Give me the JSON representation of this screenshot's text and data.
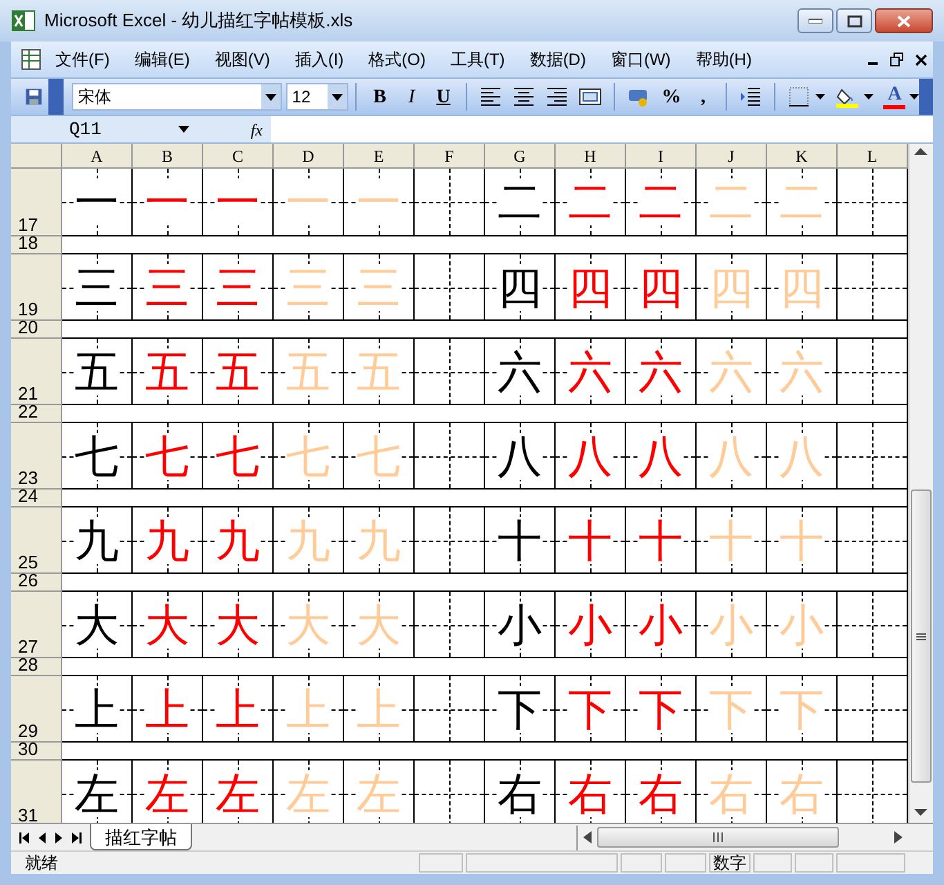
{
  "window": {
    "title": "Microsoft Excel - 幼儿描红字帖模板.xls"
  },
  "menu": [
    "文件(F)",
    "编辑(E)",
    "视图(V)",
    "插入(I)",
    "格式(O)",
    "工具(T)",
    "数据(D)",
    "窗口(W)",
    "帮助(H)"
  ],
  "toolbar": {
    "font": "宋体",
    "size": "12",
    "groups": [
      [
        {
          "kind": "bold",
          "label": "B"
        },
        {
          "kind": "italic",
          "label": "I"
        },
        {
          "kind": "underline",
          "label": "U"
        }
      ],
      [
        {
          "kind": "align-left"
        },
        {
          "kind": "align-center"
        },
        {
          "kind": "align-right"
        },
        {
          "kind": "merge"
        }
      ],
      [
        {
          "kind": "currency"
        },
        {
          "kind": "text",
          "label": "%"
        },
        {
          "kind": "text",
          "label": ","
        }
      ],
      [
        {
          "kind": "indent"
        }
      ],
      [
        {
          "kind": "borders"
        },
        {
          "kind": "fill-color"
        },
        {
          "kind": "font-color",
          "label": "A"
        }
      ]
    ]
  },
  "formula_bar": {
    "name_box": "Q11",
    "fx": "fx"
  },
  "columns": [
    "A",
    "B",
    "C",
    "D",
    "E",
    "F",
    "G",
    "H",
    "I",
    "J",
    "K",
    "L"
  ],
  "rows": [
    {
      "number": "17",
      "kind": "char",
      "cells": [
        {
          "text": "一",
          "color": "#000000"
        },
        {
          "text": "一",
          "color": "#ff0000"
        },
        {
          "text": "一",
          "color": "#ff0000"
        },
        {
          "text": "一",
          "color": "#ffcc99"
        },
        {
          "text": "一",
          "color": "#ffcc99"
        },
        null,
        {
          "text": "二",
          "color": "#000000"
        },
        {
          "text": "二",
          "color": "#ff0000"
        },
        {
          "text": "二",
          "color": "#ff0000"
        },
        {
          "text": "二",
          "color": "#ffcc99"
        },
        {
          "text": "二",
          "color": "#ffcc99"
        },
        null
      ]
    },
    {
      "number": "18",
      "kind": "gap"
    },
    {
      "number": "19",
      "kind": "char",
      "cells": [
        {
          "text": "三",
          "color": "#000000"
        },
        {
          "text": "三",
          "color": "#ff0000"
        },
        {
          "text": "三",
          "color": "#ff0000"
        },
        {
          "text": "三",
          "color": "#ffcc99"
        },
        {
          "text": "三",
          "color": "#ffcc99"
        },
        null,
        {
          "text": "四",
          "color": "#000000"
        },
        {
          "text": "四",
          "color": "#ff0000"
        },
        {
          "text": "四",
          "color": "#ff0000"
        },
        {
          "text": "四",
          "color": "#ffcc99"
        },
        {
          "text": "四",
          "color": "#ffcc99"
        },
        null
      ]
    },
    {
      "number": "20",
      "kind": "gap"
    },
    {
      "number": "21",
      "kind": "char",
      "cells": [
        {
          "text": "五",
          "color": "#000000"
        },
        {
          "text": "五",
          "color": "#ff0000"
        },
        {
          "text": "五",
          "color": "#ff0000"
        },
        {
          "text": "五",
          "color": "#ffcc99"
        },
        {
          "text": "五",
          "color": "#ffcc99"
        },
        null,
        {
          "text": "六",
          "color": "#000000"
        },
        {
          "text": "六",
          "color": "#ff0000"
        },
        {
          "text": "六",
          "color": "#ff0000"
        },
        {
          "text": "六",
          "color": "#ffcc99"
        },
        {
          "text": "六",
          "color": "#ffcc99"
        },
        null
      ]
    },
    {
      "number": "22",
      "kind": "gap"
    },
    {
      "number": "23",
      "kind": "char",
      "cells": [
        {
          "text": "七",
          "color": "#000000"
        },
        {
          "text": "七",
          "color": "#ff0000"
        },
        {
          "text": "七",
          "color": "#ff0000"
        },
        {
          "text": "七",
          "color": "#ffcc99"
        },
        {
          "text": "七",
          "color": "#ffcc99"
        },
        null,
        {
          "text": "八",
          "color": "#000000"
        },
        {
          "text": "八",
          "color": "#ff0000"
        },
        {
          "text": "八",
          "color": "#ff0000"
        },
        {
          "text": "八",
          "color": "#ffcc99"
        },
        {
          "text": "八",
          "color": "#ffcc99"
        },
        null
      ]
    },
    {
      "number": "24",
      "kind": "gap"
    },
    {
      "number": "25",
      "kind": "char",
      "cells": [
        {
          "text": "九",
          "color": "#000000"
        },
        {
          "text": "九",
          "color": "#ff0000"
        },
        {
          "text": "九",
          "color": "#ff0000"
        },
        {
          "text": "九",
          "color": "#ffcc99"
        },
        {
          "text": "九",
          "color": "#ffcc99"
        },
        null,
        {
          "text": "十",
          "color": "#000000"
        },
        {
          "text": "十",
          "color": "#ff0000"
        },
        {
          "text": "十",
          "color": "#ff0000"
        },
        {
          "text": "十",
          "color": "#ffcc99"
        },
        {
          "text": "十",
          "color": "#ffcc99"
        },
        null
      ]
    },
    {
      "number": "26",
      "kind": "gap"
    },
    {
      "number": "27",
      "kind": "char",
      "cells": [
        {
          "text": "大",
          "color": "#000000"
        },
        {
          "text": "大",
          "color": "#ff0000"
        },
        {
          "text": "大",
          "color": "#ff0000"
        },
        {
          "text": "大",
          "color": "#ffcc99"
        },
        {
          "text": "大",
          "color": "#ffcc99"
        },
        null,
        {
          "text": "小",
          "color": "#000000"
        },
        {
          "text": "小",
          "color": "#ff0000"
        },
        {
          "text": "小",
          "color": "#ff0000"
        },
        {
          "text": "小",
          "color": "#ffcc99"
        },
        {
          "text": "小",
          "color": "#ffcc99"
        },
        null
      ]
    },
    {
      "number": "28",
      "kind": "gap"
    },
    {
      "number": "29",
      "kind": "char",
      "cells": [
        {
          "text": "上",
          "color": "#000000"
        },
        {
          "text": "上",
          "color": "#ff0000"
        },
        {
          "text": "上",
          "color": "#ff0000"
        },
        {
          "text": "上",
          "color": "#ffcc99"
        },
        {
          "text": "上",
          "color": "#ffcc99"
        },
        null,
        {
          "text": "下",
          "color": "#000000"
        },
        {
          "text": "下",
          "color": "#ff0000"
        },
        {
          "text": "下",
          "color": "#ff0000"
        },
        {
          "text": "下",
          "color": "#ffcc99"
        },
        {
          "text": "下",
          "color": "#ffcc99"
        },
        null
      ]
    },
    {
      "number": "30",
      "kind": "gap"
    },
    {
      "number": "31",
      "kind": "char",
      "cells": [
        {
          "text": "左",
          "color": "#000000"
        },
        {
          "text": "左",
          "color": "#ff0000"
        },
        {
          "text": "左",
          "color": "#ff0000"
        },
        {
          "text": "左",
          "color": "#ffcc99"
        },
        {
          "text": "左",
          "color": "#ffcc99"
        },
        null,
        {
          "text": "右",
          "color": "#000000"
        },
        {
          "text": "右",
          "color": "#ff0000"
        },
        {
          "text": "右",
          "color": "#ff0000"
        },
        {
          "text": "右",
          "color": "#ffcc99"
        },
        {
          "text": "右",
          "color": "#ffcc99"
        },
        null
      ]
    }
  ],
  "sheet_tabs": [
    {
      "label": "描红字帖",
      "selected": true
    }
  ],
  "status_bar": {
    "message": "就绪",
    "indicators": [
      "数字"
    ]
  }
}
